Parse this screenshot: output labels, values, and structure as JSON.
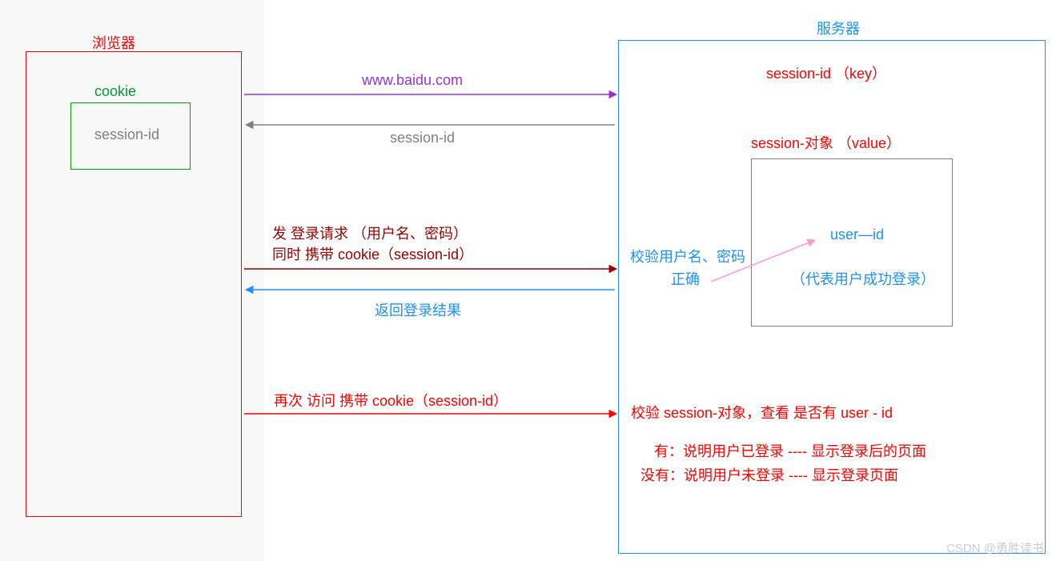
{
  "browser": {
    "title": "浏览器",
    "cookie_label": "cookie",
    "cookie_value": "session-id"
  },
  "server": {
    "title": "服务器",
    "session_key_label": "session-id （key）",
    "session_value_label": "session-对象 （value）",
    "object_box": {
      "user_id": "user—id",
      "note": "（代表用户成功登录）"
    },
    "verify_label_line1": "校验用户名、密码",
    "verify_label_line2": "正确",
    "check_line": "校验  session-对象，查看 是否有  user - id",
    "has_line": "有：说明用户已登录 ---- 显示登录后的页面",
    "not_line": "没有：说明用户未登录 ---- 显示登录页面"
  },
  "arrows": {
    "a1_label": "www.baidu.com",
    "a2_label": "session-id",
    "a3_label_line1": "发 登录请求 （用户名、密码）",
    "a3_label_line2": "同时 携带 cookie（session-id）",
    "a4_label": "返回登录结果",
    "a5_label": "再次 访问 携带 cookie（session-id）"
  },
  "watermark": "CSDN @勇胜读书",
  "colors": {
    "red": "#ff0000",
    "green": "#00a000",
    "green_text": "#009933",
    "gray": "#808080",
    "purple": "#9933cc",
    "darkred": "#990000",
    "blue_line": "#1e90ff",
    "blue_text": "#1e90ff",
    "pink": "#ff99cc",
    "box_gray": "#808080"
  }
}
